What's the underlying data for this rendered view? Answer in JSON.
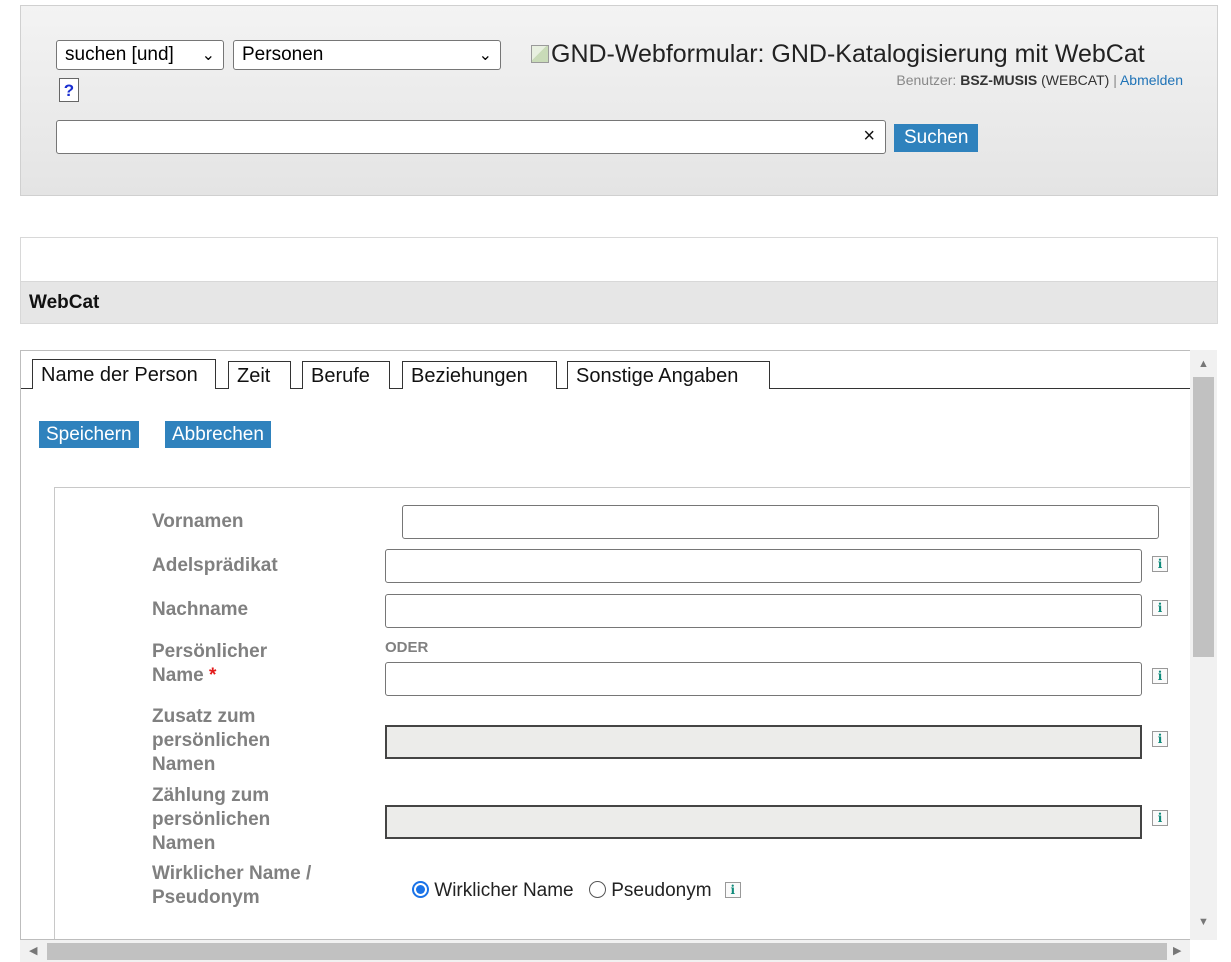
{
  "header": {
    "operator_select": "suchen [und]",
    "index_select": "Personen",
    "help_label": "?",
    "brand_text": "GND-Webformular: GND-Katalogisierung mit WebCat",
    "user_prefix": "Benutzer:",
    "user_name": "BSZ-MUSIS",
    "user_context": "(WEBCAT)",
    "separator": "|",
    "logout_link": "Abmelden",
    "search_value": "",
    "clear_glyph": "×",
    "search_button": "Suchen"
  },
  "app_title": "WebCat",
  "tabs": [
    {
      "label": "Name der Person",
      "active": true
    },
    {
      "label": "Zeit",
      "active": false
    },
    {
      "label": "Berufe",
      "active": false
    },
    {
      "label": "Beziehungen",
      "active": false
    },
    {
      "label": "Sonstige Angaben",
      "active": false
    }
  ],
  "actions": {
    "save": "Speichern",
    "cancel": "Abbrechen"
  },
  "form": {
    "vornamen_label": "Vornamen",
    "adel_label": "Adelsprädikat",
    "nachname_label": "Nachname",
    "oder_text": "ODER",
    "pers_name_label_1": "Persönlicher",
    "pers_name_label_2": "Name",
    "required_mark": "*",
    "zusatz_label_1": "Zusatz zum",
    "zusatz_label_2": "persönlichen",
    "zusatz_label_3": "Namen",
    "zaehlung_label_1": "Zählung zum",
    "zaehlung_label_2": "persönlichen",
    "zaehlung_label_3": "Namen",
    "wirklich_label_1": "Wirklicher Name /",
    "wirklich_label_2": "Pseudonym",
    "radio_real": "Wirklicher Name",
    "radio_pseudo": "Pseudonym",
    "info_glyph": "i"
  }
}
